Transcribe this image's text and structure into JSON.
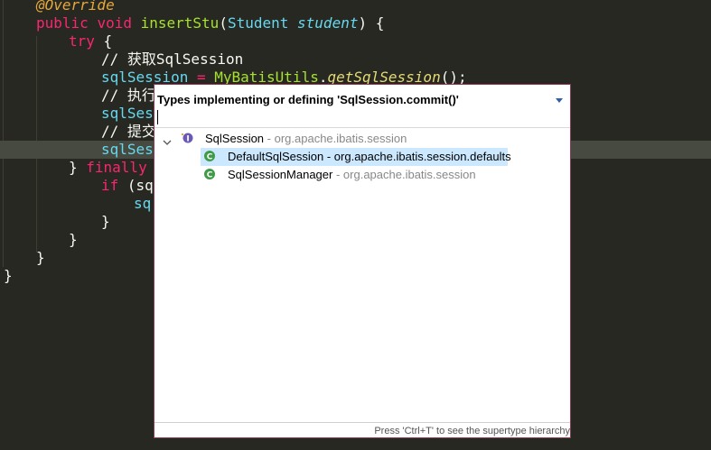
{
  "editor": {
    "lines": {
      "l0": {
        "annotation": "@Override"
      },
      "l1": {
        "kw_public": "public",
        "kw_void": "void",
        "method": "insertStu",
        "open_paren": "(",
        "param_type": "Student",
        "param_name": "student",
        "close": ") {"
      },
      "l2": {
        "kw_try": "try",
        "brace": " {"
      },
      "l3": {
        "comment": "// 获取SqlSession"
      },
      "l4": {
        "var": "sqlSession",
        "eq": " = ",
        "cls": "MyBatisUtils",
        "dot": ".",
        "call": "getSqlSession",
        "end": "();"
      },
      "l5": {
        "comment": "// 执行"
      },
      "l6": {
        "text": "sqlSess"
      },
      "l7": {
        "comment": "// 提交"
      },
      "l8": {
        "text": "sqlSess"
      },
      "l9": {
        "close": "} ",
        "kw_finally": "finally",
        "brace": " {"
      },
      "l10": {
        "kw_if": "if",
        "rest": " (sq"
      },
      "l11": {
        "text": "sq"
      },
      "l12": {
        "text": "}"
      },
      "l13": {
        "text": "}"
      },
      "l14": {
        "text": "}"
      },
      "l15": {
        "text": "}"
      }
    }
  },
  "popup": {
    "title": "Types implementing or defining 'SqlSession.commit()'",
    "menu_icon": "chevron-down-icon",
    "rows": [
      {
        "name": "SqlSession",
        "separator": " - ",
        "package": "org.apache.ibatis.session",
        "icon": "interface-icon",
        "expanded": true
      },
      {
        "name": "DefaultSqlSession",
        "separator": " - ",
        "package": "org.apache.ibatis.session.defaults",
        "icon": "class-icon",
        "selected": true
      },
      {
        "name": "SqlSessionManager",
        "separator": " - ",
        "package": "org.apache.ibatis.session",
        "icon": "class-icon"
      }
    ],
    "footer": "Press 'Ctrl+T' to see the supertype hierarchy"
  },
  "colors": {
    "editor_bg": "#272822",
    "keyword": "#F92672",
    "method": "#A6E22E",
    "type": "#66D9EF",
    "annotation": "#E6A83C",
    "selection": "#CCE8FF",
    "popup_border": "#8E3A55"
  }
}
